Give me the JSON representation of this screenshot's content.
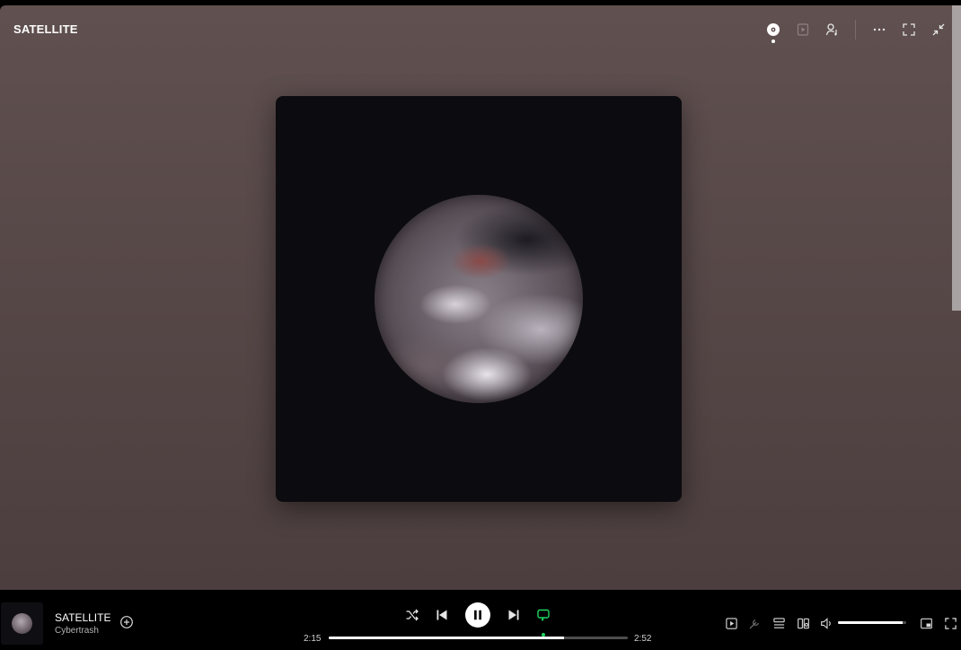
{
  "header": {
    "title": "SATELLITE",
    "icons": [
      "now-playing-view-icon",
      "queue-play-icon",
      "connect-friends-icon",
      "more-options-icon",
      "fullscreen-icon",
      "collapse-icon"
    ]
  },
  "cover": {
    "description_icon": "album-art-orb"
  },
  "player": {
    "track_title": "SATELLITE",
    "artist": "Cybertrash",
    "time_elapsed": "2:15",
    "time_total": "2:52",
    "progress_fraction": 0.787,
    "volume_fraction": 0.95,
    "repeat_active": true,
    "accent_color": "#1ed760"
  }
}
